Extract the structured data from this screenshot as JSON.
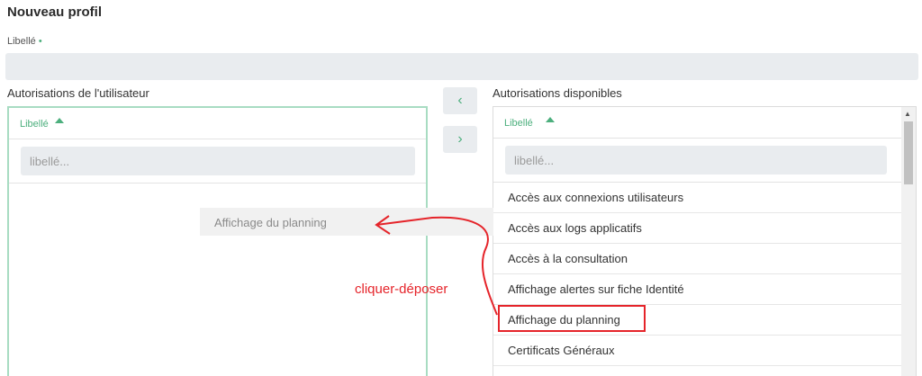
{
  "page": {
    "title": "Nouveau profil"
  },
  "form": {
    "libelle_label": "Libellé",
    "required_marker": "•",
    "libelle_value": ""
  },
  "user_auth": {
    "section_title": "Autorisations de l'utilisateur",
    "column": "Libellé",
    "filter_placeholder": "libellé...",
    "items": []
  },
  "available_auth": {
    "section_title": "Autorisations disponibles",
    "column": "Libellé",
    "filter_placeholder": "libellé...",
    "items": [
      "Accès aux connexions utilisateurs",
      "Accès aux logs applicatifs",
      "Accès à la consultation",
      "Affichage alertes sur fiche Identité",
      "Affichage du planning",
      "Certificats Généraux"
    ]
  },
  "buttons": {
    "move_left": "‹",
    "move_right": "›"
  },
  "drag": {
    "ghost_label": "Affichage du planning",
    "annotation": "cliquer-déposer"
  },
  "colors": {
    "accent": "#4caf7d",
    "annotation": "#e5242a"
  }
}
